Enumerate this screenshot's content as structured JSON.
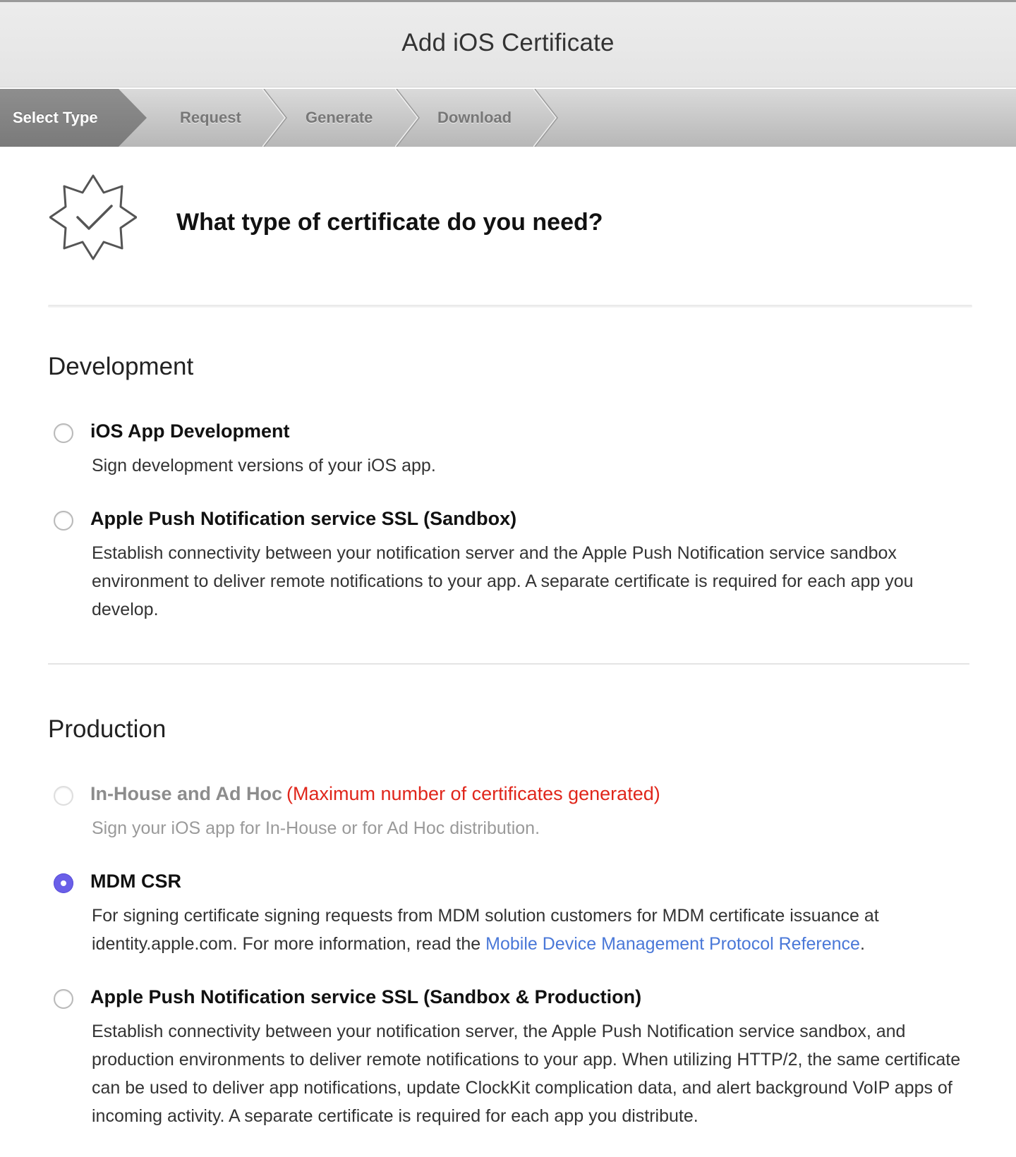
{
  "window": {
    "title": "Add iOS Certificate"
  },
  "steps": [
    {
      "label": "Select Type",
      "active": true
    },
    {
      "label": "Request",
      "active": false
    },
    {
      "label": "Generate",
      "active": false
    },
    {
      "label": "Download",
      "active": false
    }
  ],
  "header": {
    "icon": "certificate-badge-icon",
    "heading": "What type of certificate do you need?"
  },
  "development": {
    "title": "Development",
    "options": [
      {
        "title": "iOS App Development",
        "description": "Sign development versions of your iOS app.",
        "selected": false,
        "disabled": false
      },
      {
        "title": "Apple Push Notification service SSL (Sandbox)",
        "description": "Establish connectivity between your notification server and the Apple Push Notification service sandbox environment to deliver remote notifications to your app. A separate certificate is required for each app you develop.",
        "selected": false,
        "disabled": false
      }
    ]
  },
  "production": {
    "title": "Production",
    "inhouse": {
      "title": "In-House and Ad Hoc",
      "warning": "(Maximum number of certificates generated)",
      "description": "Sign your iOS app for In-House or for Ad Hoc distribution.",
      "selected": false,
      "disabled": true
    },
    "mdm": {
      "title": "MDM CSR",
      "description_before": "For signing certificate signing requests from MDM solution customers for MDM certificate issuance at identity.apple.com. For more information, read the",
      "link": "Mobile Device Management Protocol Reference",
      "description_after": ".",
      "selected": true,
      "disabled": false
    },
    "apns": {
      "title": "Apple Push Notification service SSL (Sandbox & Production)",
      "description": "Establish connectivity between your notification server, the Apple Push Notification service sandbox, and production environments to deliver remote notifications to your app. When utilizing HTTP/2, the same certificate can be used to deliver app notifications, update ClockKit complication data, and alert background VoIP apps of incoming activity. A separate certificate is required for each app you distribute.",
      "selected": false,
      "disabled": false
    }
  },
  "colors": {
    "accent": "#6a5fe8",
    "warning": "#e0261b",
    "link": "#4a78d8",
    "active_step": "#858585"
  }
}
